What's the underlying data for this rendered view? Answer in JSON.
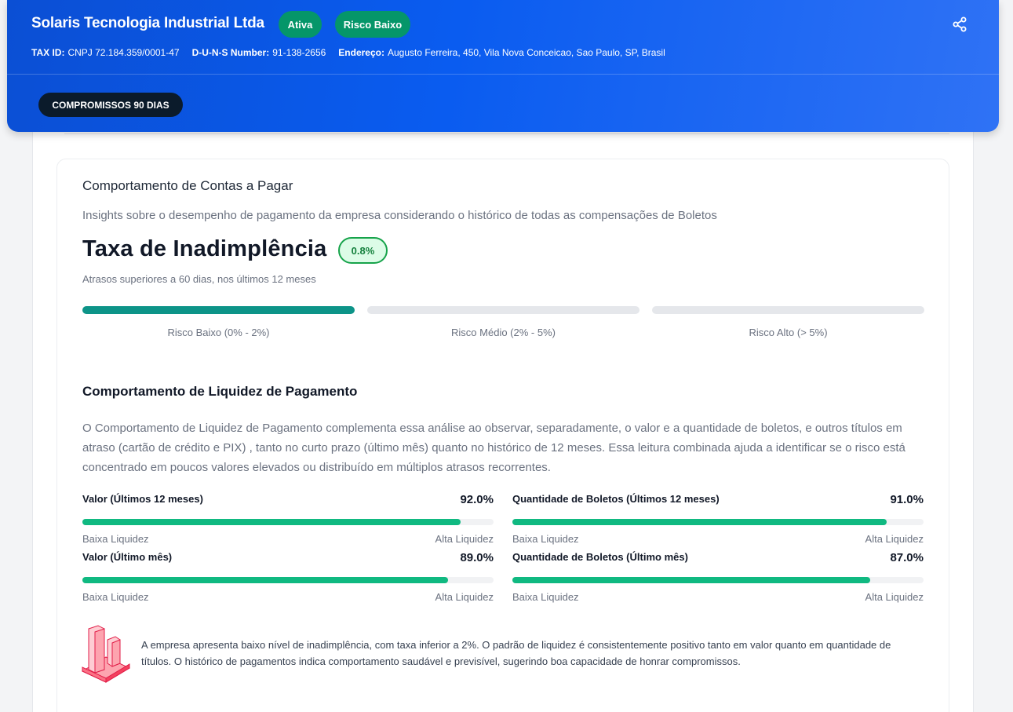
{
  "header": {
    "company_name": "Solaris Tecnologia Industrial Ltda",
    "status_badge": "Ativa",
    "risk_badge": "Risco Baixo",
    "share_icon": "share-icon",
    "tax_id_label": "TAX ID:",
    "tax_id_value": "CNPJ 72.184.359/0001-47",
    "duns_label": "D-U-N-S Number:",
    "duns_value": "91-138-2656",
    "address_label": "Endereço:",
    "address_value": "Augusto Ferreira, 450, Vila Nova Conceicao, Sao Paulo, SP, Brasil",
    "commitments_button": "COMPROMISSOS 90 DIAS"
  },
  "card": {
    "title": "Comportamento de Contas a Pagar",
    "subtitle": "Insights sobre o desempenho de pagamento da empresa considerando o histórico de todas as compensações de Boletos",
    "default_rate": {
      "title": "Taxa de Inadimplência",
      "value": "0.8%",
      "note": "Atrasos superiores a 60 dias, nos últimos 12 meses",
      "active_band": 0,
      "bands": [
        {
          "label": "Risco Baixo (0% - 2%)"
        },
        {
          "label": "Risco Médio (2% - 5%)"
        },
        {
          "label": "Risco Alto (> 5%)"
        }
      ]
    },
    "liquidity": {
      "title": "Comportamento de Liquidez de Pagamento",
      "description": "O Comportamento de Liquidez de Pagamento complementa essa análise ao observar, separadamente, o valor e a quantidade de boletos, e outros títulos em atraso (cartão de crédito e PIX) , tanto no curto prazo (último mês) quanto no histórico de 12 meses. Essa leitura combinada ajuda a identificar se o risco está concentrado em poucos valores elevados ou distribuído em múltiplos atrasos recorrentes.",
      "low_label": "Baixa Liquidez",
      "high_label": "Alta Liquidez",
      "fill_color": "#10b981",
      "metrics": [
        {
          "label": "Valor (Últimos 12 meses)",
          "value": "92.0%",
          "fraction": 0.92
        },
        {
          "label": "Quantidade de Boletos (Últimos 12 meses)",
          "value": "91.0%",
          "fraction": 0.91
        },
        {
          "label": "Valor (Último mês)",
          "value": "89.0%",
          "fraction": 0.89
        },
        {
          "label": "Quantidade de Boletos (Último mês)",
          "value": "87.0%",
          "fraction": 0.87
        }
      ]
    },
    "summary": {
      "icon": "bar-chart-icon",
      "text": "A empresa apresenta baixo nível de inadimplência, com taxa inferior a 2%. O padrão de liquidez é consistentemente positivo tanto em valor quanto em quantidade de títulos. O histórico de pagamentos indica comportamento saudável e previsível, sugerindo boa capacidade de honrar compromissos."
    }
  }
}
